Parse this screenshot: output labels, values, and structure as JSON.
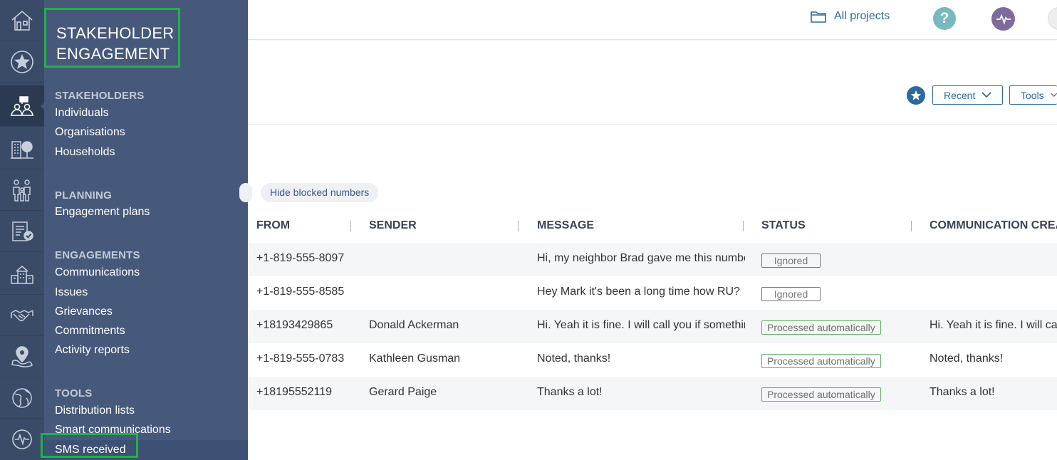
{
  "module": {
    "title_line1": "STAKEHOLDER",
    "title_line2": "ENGAGEMENT"
  },
  "nav": {
    "sections": [
      {
        "heading": "STAKEHOLDERS",
        "items": [
          "Individuals",
          "Organisations",
          "Households"
        ]
      },
      {
        "heading": "PLANNING",
        "items": [
          "Engagement plans"
        ]
      },
      {
        "heading": "ENGAGEMENTS",
        "items": [
          "Communications",
          "Issues",
          "Grievances",
          "Commitments",
          "Activity reports"
        ]
      },
      {
        "heading": "TOOLS",
        "items": [
          "Distribution lists",
          "Smart communications",
          "SMS received"
        ]
      }
    ]
  },
  "topbar": {
    "all_projects": "All projects",
    "help": "?"
  },
  "toolbar": {
    "recent": "Recent",
    "tools": "Tools"
  },
  "filters": {
    "hide_blocked": "Hide blocked numbers"
  },
  "table": {
    "headers": [
      "FROM",
      "SENDER",
      "MESSAGE",
      "STATUS",
      "COMMUNICATION CREAT"
    ],
    "rows": [
      {
        "from": "+1-819-555-8097",
        "sender": "",
        "message": "Hi, my neighbor Brad gave me this number",
        "status": "Ignored",
        "comm": ""
      },
      {
        "from": "+1-819-555-8585",
        "sender": "",
        "message": "Hey Mark it's been a long time how RU?",
        "status": "Ignored",
        "comm": ""
      },
      {
        "from": "+18193429865",
        "sender": "Donald Ackerman",
        "message": "Hi. Yeah it is fine. I will call you if something",
        "status": "Processed automatically",
        "comm": "Hi. Yeah it is fine. I will call"
      },
      {
        "from": "+1-819-555-0783",
        "sender": "Kathleen Gusman",
        "message": "Noted, thanks!",
        "status": "Processed automatically",
        "comm": "Noted, thanks!"
      },
      {
        "from": "+18195552119",
        "sender": "Gerard Paige",
        "message": "Thanks a lot!",
        "status": "Processed automatically",
        "comm": "Thanks a lot!"
      }
    ]
  },
  "colors": {
    "rail": "#3a4b68",
    "nav": "#46597b",
    "highlight": "#22b14c",
    "link": "#2d6aa0",
    "processed": "#5fb35f"
  }
}
